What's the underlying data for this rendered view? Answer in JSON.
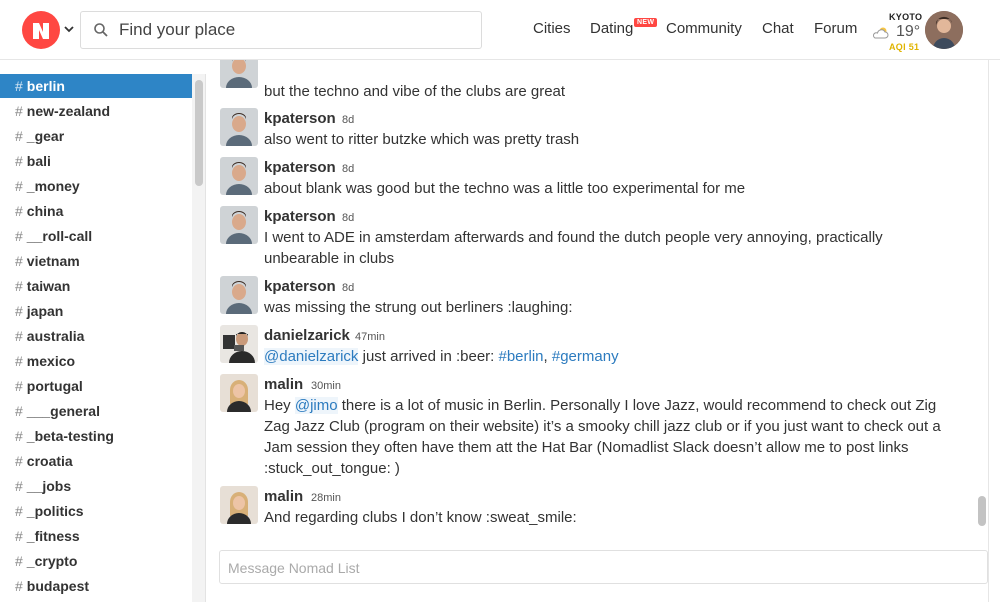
{
  "header": {
    "search_placeholder": "Find your place",
    "nav": {
      "cities": "Cities",
      "dating": "Dating",
      "dating_badge": "NEW",
      "community": "Community",
      "chat": "Chat",
      "forum": "Forum"
    },
    "weather": {
      "city": "KYOTO",
      "temp": "19°",
      "aqi_label": "AQI",
      "aqi_value": "51"
    }
  },
  "sidebar": {
    "channels": [
      {
        "name": "berlin",
        "active": true
      },
      {
        "name": "new-zealand"
      },
      {
        "name": "_gear"
      },
      {
        "name": "bali"
      },
      {
        "name": "_money"
      },
      {
        "name": "china"
      },
      {
        "name": "__roll-call"
      },
      {
        "name": "vietnam"
      },
      {
        "name": "taiwan"
      },
      {
        "name": "japan"
      },
      {
        "name": "australia"
      },
      {
        "name": "mexico"
      },
      {
        "name": "portugal"
      },
      {
        "name": "___general"
      },
      {
        "name": "_beta-testing"
      },
      {
        "name": "croatia"
      },
      {
        "name": "__jobs"
      },
      {
        "name": "_politics"
      },
      {
        "name": "_fitness"
      },
      {
        "name": "_crypto"
      },
      {
        "name": "budapest"
      }
    ]
  },
  "messages": [
    {
      "user": "kpaterson",
      "time": "8d",
      "text": "but the techno and vibe of the clubs are great"
    },
    {
      "user": "kpaterson",
      "time": "8d",
      "text": "also went to ritter butzke which was pretty trash"
    },
    {
      "user": "kpaterson",
      "time": "8d",
      "text": "about blank was good but the techno was a little too experimental for me"
    },
    {
      "user": "kpaterson",
      "time": "8d",
      "text": "I went to ADE in amsterdam afterwards and found the dutch people very annoying, practically unbearable in clubs"
    },
    {
      "user": "kpaterson",
      "time": "8d",
      "text": "was missing the strung out berliners :laughing:"
    },
    {
      "user": "danielzarick",
      "time": "47min",
      "mention": "@danielzarick",
      "text_a": " just arrived in :beer: ",
      "tag1": "#berlin",
      "comma": ", ",
      "tag2": "#germany"
    },
    {
      "user": "malin",
      "time": "30min",
      "pre": "Hey ",
      "mention": "@jimo",
      "text": " there is a lot of music in Berlin. Personally I love Jazz, would recommend to check out Zig Zag Jazz Club (program on their website) it’s a smooky chill jazz club or if you just want to check out a Jam session they often have them att the Hat Bar (Nomadlist Slack doesn’t allow me to post links :stuck_out_tongue: )"
    },
    {
      "user": "malin",
      "time": "28min",
      "text": "And regarding clubs I don’t know :sweat_smile:"
    }
  ],
  "composer": {
    "placeholder": "Message Nomad List"
  },
  "colors": {
    "brand": "#ff4742",
    "active_channel": "#2e85c6",
    "link": "#2c7bbf",
    "aqi": "#e0b400"
  },
  "icons": {
    "logo": "nomadlist-logo-icon",
    "search": "search-icon",
    "weather": "partly-cloudy-icon",
    "caret": "chevron-down-icon"
  }
}
